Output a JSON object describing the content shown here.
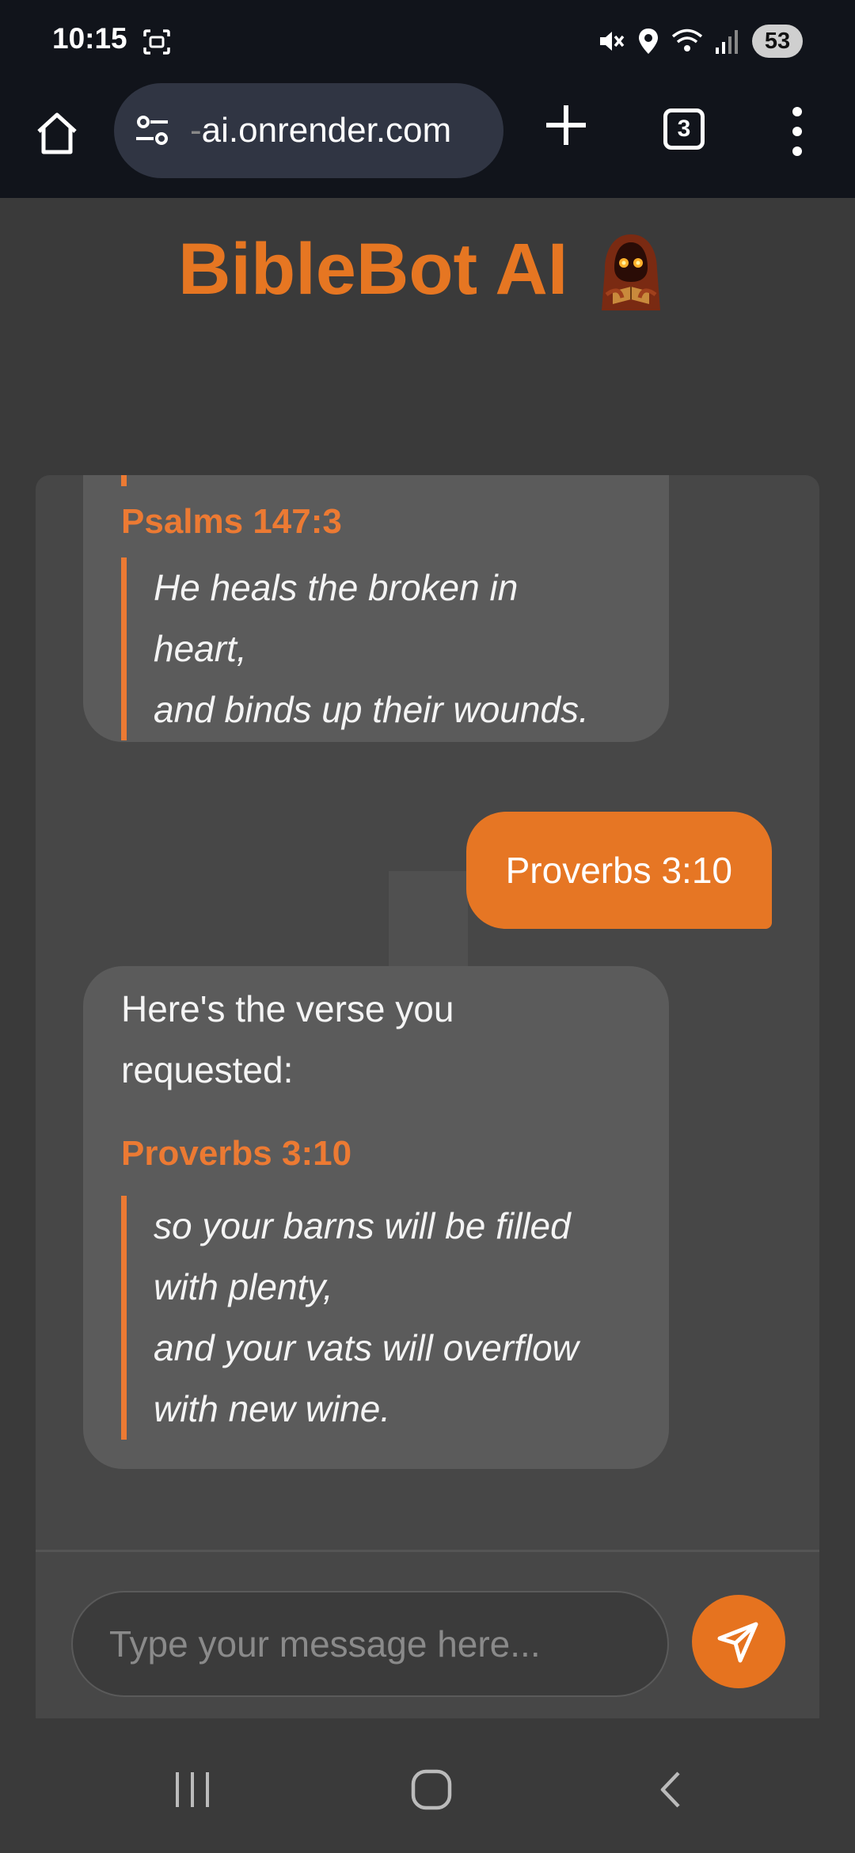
{
  "status_bar": {
    "time": "10:15",
    "battery": "53",
    "icons": [
      "screenshot-icon",
      "mute-icon",
      "location-icon",
      "wifi-icon",
      "signal-icon"
    ]
  },
  "browser": {
    "url_prefix": "-",
    "url": "ai.onrender.com",
    "tab_count": "3",
    "icons": [
      "home-icon",
      "site-settings-icon",
      "new-tab-icon",
      "tabs-icon",
      "more-menu-icon"
    ]
  },
  "app": {
    "title": "BibleBot AI",
    "accent_color": "#e67622"
  },
  "messages": [
    {
      "role": "bot",
      "ref": "Psalms 147:3",
      "lines": [
        "He heals the broken in",
        "heart,",
        "and binds up their wounds."
      ]
    },
    {
      "role": "user",
      "text": "Proverbs 3:10"
    },
    {
      "role": "bot",
      "intro": [
        "Here's the verse you",
        "requested:"
      ],
      "ref": "Proverbs 3:10",
      "lines": [
        "so your barns will be filled",
        "with plenty,",
        "and your vats will overflow",
        "with new wine."
      ]
    }
  ],
  "composer": {
    "placeholder": "Type your message here...",
    "send_icon": "send-icon"
  },
  "nav": {
    "icons": [
      "recents-icon",
      "home-nav-icon",
      "back-icon"
    ]
  }
}
